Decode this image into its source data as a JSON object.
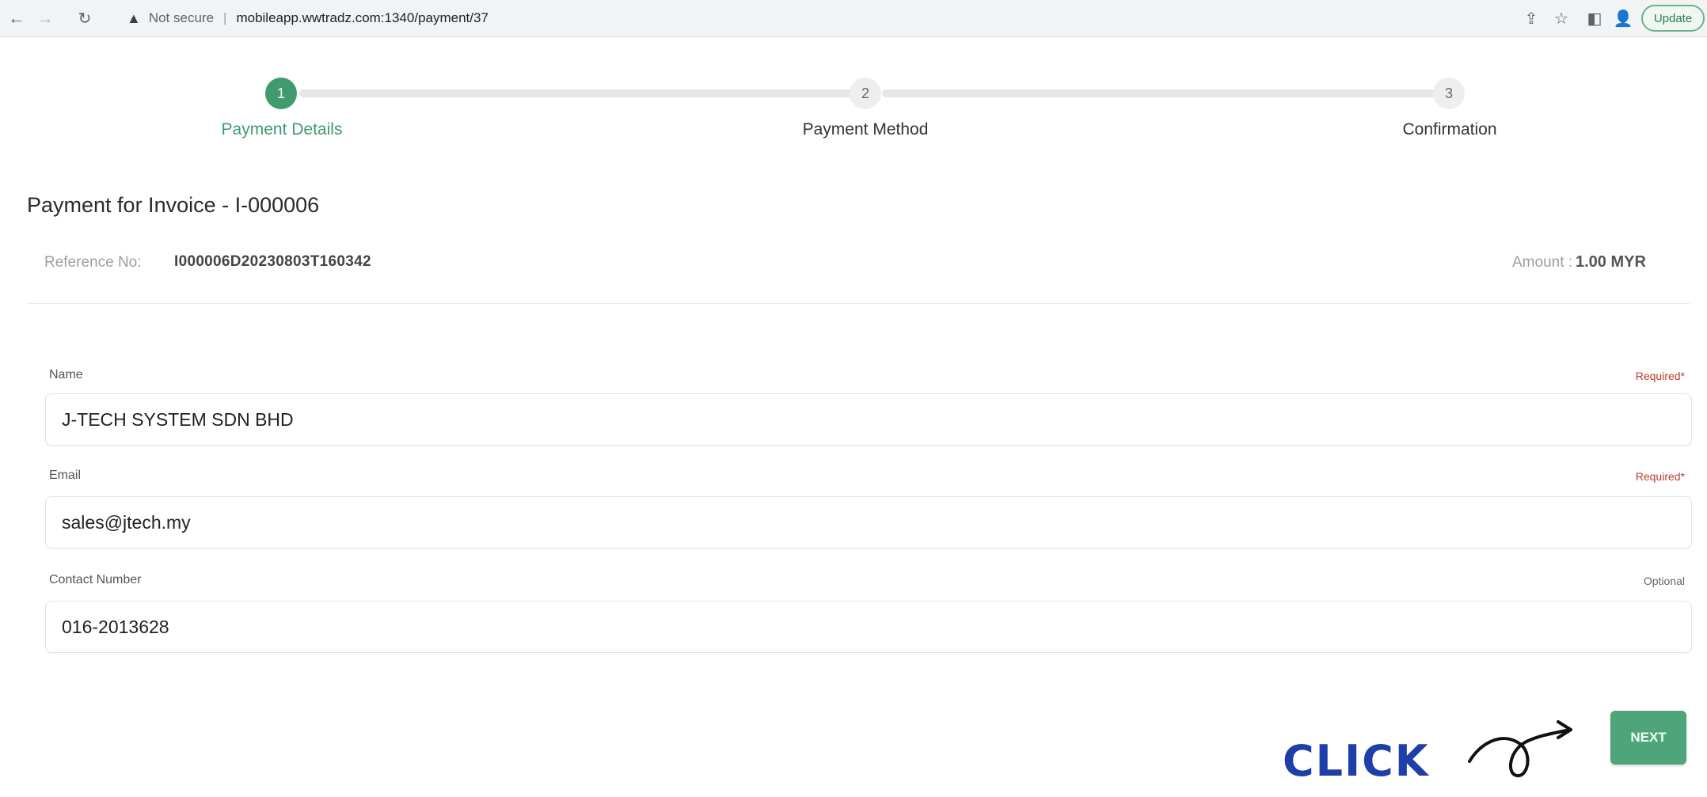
{
  "browser": {
    "warning_icon": "warning-triangle-icon",
    "not_secure": "Not secure",
    "separator": "|",
    "url": "mobileapp.wwtradz.com:1340/payment/37",
    "update_label": "Update"
  },
  "stepper": {
    "steps": [
      {
        "number": "1",
        "label": "Payment Details",
        "state": "active"
      },
      {
        "number": "2",
        "label": "Payment Method",
        "state": "todo"
      },
      {
        "number": "3",
        "label": "Confirmation",
        "state": "todo"
      }
    ],
    "active_color": "#3f9b6e"
  },
  "payment": {
    "title": "Payment for Invoice - I-000006",
    "reference_label": "Reference No:",
    "reference_value": "I000006D20230803T160342",
    "amount_label": "Amount :",
    "amount_value": "1.00 MYR"
  },
  "form": {
    "name": {
      "label": "Name",
      "hint": "Required*",
      "value": "J-TECH SYSTEM SDN BHD"
    },
    "email": {
      "label": "Email",
      "hint": "Required*",
      "value": "sales@jtech.my"
    },
    "contact": {
      "label": "Contact Number",
      "hint": "Optional",
      "value": "016-2013628"
    }
  },
  "annotation": {
    "click_text": "CLICK",
    "color": "#1f3fa8"
  },
  "actions": {
    "next_label": "NEXT",
    "button_color": "#4fa57a"
  }
}
